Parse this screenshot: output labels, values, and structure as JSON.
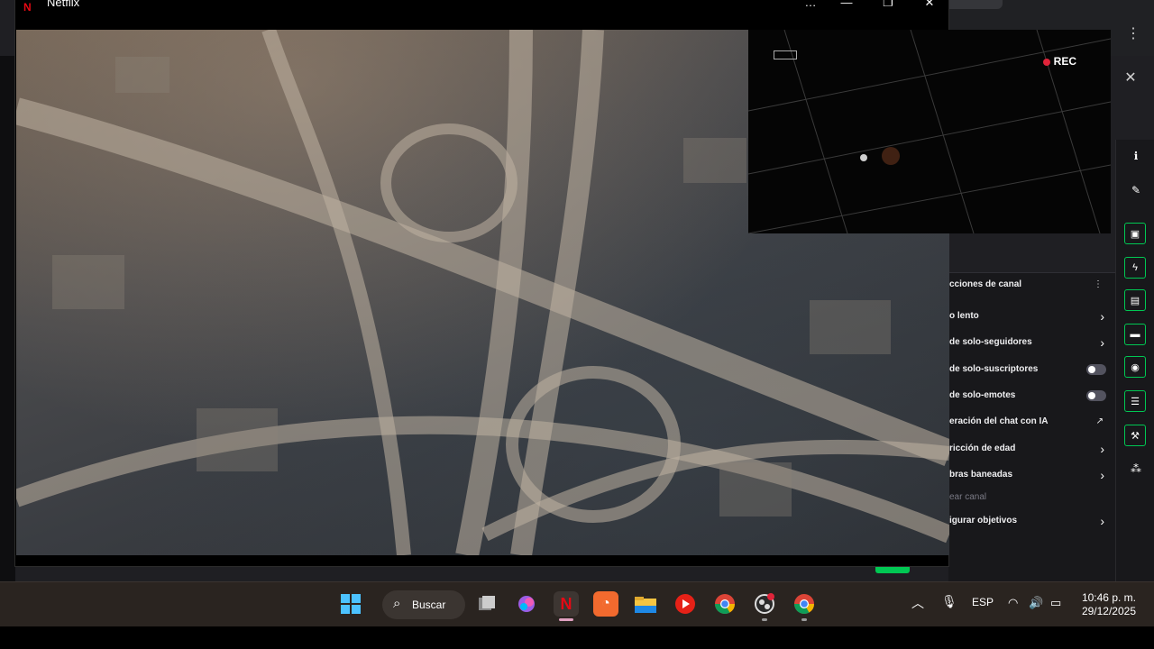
{
  "netflix_window": {
    "title": "Netflix",
    "logo_glyph": "N",
    "controls": {
      "more": "…",
      "minimize": "—",
      "maximize": "❐",
      "close": "✕"
    }
  },
  "pip_overlay": {
    "rec_label": "REC"
  },
  "chat_settings": {
    "header": "cciones de canal",
    "more_icon": "⋮",
    "items": [
      {
        "label": "o lento",
        "control": "chevron"
      },
      {
        "label": "de solo-seguidores",
        "control": "chevron"
      },
      {
        "label": "de solo-suscriptores",
        "control": "toggle",
        "toggle_on": false
      },
      {
        "label": "de solo-emotes",
        "control": "toggle",
        "toggle_on": false
      },
      {
        "label": "eración del chat con IA",
        "control": "external"
      },
      {
        "label": "ricción de edad",
        "control": "chevron"
      },
      {
        "label": "bras baneadas",
        "control": "chevron"
      },
      {
        "label": "ear canal",
        "control": "none"
      },
      {
        "label": "igurar objetivos",
        "control": "chevron"
      }
    ],
    "chevron_glyph": "›",
    "external_glyph": "↗"
  },
  "browser_bg": {
    "close_glyph": "✕",
    "menu_glyph": "⋮"
  },
  "taskbar": {
    "search_label": "Buscar",
    "search_icon": "search-icon",
    "language": "ESP",
    "time": "10:46 p. m.",
    "date": "29/12/2025"
  },
  "colors": {
    "accent_green": "#00c853",
    "netflix_red": "#e50914",
    "rec_red": "#e0243a"
  }
}
